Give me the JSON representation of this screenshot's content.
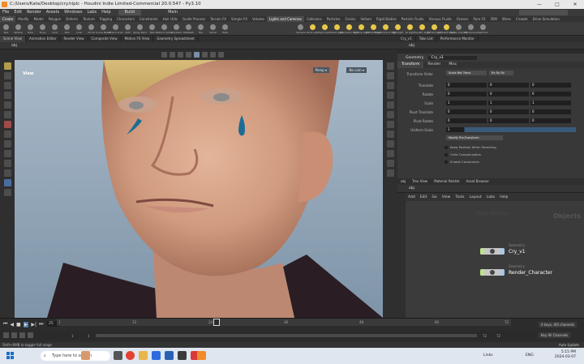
{
  "window": {
    "title": "C:/Users/Kate/Desktop/cry.hiplc - Houdini Indie Limited-Commercial 20.0.547 - Py3.10",
    "controls": [
      "—",
      "□",
      "✕"
    ]
  },
  "menu": {
    "items": [
      "File",
      "Edit",
      "Render",
      "Assets",
      "Windows",
      "Labs",
      "Help"
    ],
    "desktop": "Build",
    "right_desktop": "Main"
  },
  "shelf_tabs": [
    "Create",
    "Modify",
    "Model",
    "Polygon",
    "Deform",
    "Texture",
    "Rigging",
    "Characters",
    "Constraints",
    "Hair Utils",
    "Guide Process",
    "Terrain FX",
    "Simple FX",
    "Volume",
    "Lights and Cameras",
    "Collisions",
    "Particles",
    "Grains",
    "Vellum",
    "Rigid Bodies",
    "Particle Fluids",
    "Viscous Fluids",
    "Oceans",
    "Pyro FX",
    "FEM",
    "Wires",
    "Crowds",
    "Drive Simulation"
  ],
  "shelf_tools_left": [
    "Box",
    "Sphere",
    "Tube",
    "Torus",
    "Grid",
    "Null",
    "Line",
    "Circle",
    "Curve Bezier",
    "Draw Curve",
    "Path",
    "Spray Paint",
    "Text",
    "Platonic Solids",
    "L-System",
    "Metaball",
    "File",
    "Spiral",
    "Helix"
  ],
  "shelf_tools_right": [
    "Camera",
    "Point Light",
    "Spot Light",
    "Area Light",
    "Geometry Light",
    "Volume Light",
    "Distant Light",
    "Environment Light",
    "Sky Light",
    "GI Light",
    "Caustic Light",
    "Portal Light",
    "Ambient Light",
    "Stereo Camera",
    "VR Camera",
    "Switcher"
  ],
  "pane_tabs_left": [
    "Scene View",
    "Animation Editor",
    "Render View",
    "Composite View",
    "Motion FX View",
    "Geometry Spreadsheet"
  ],
  "pane_tabs_right": [
    "Cry_v1",
    "Take List",
    "Performance Monitor"
  ],
  "viewport": {
    "path": "obj",
    "label": "View",
    "persp": "Persp ▾",
    "cam": "No cam ▾"
  },
  "params": {
    "path": "obj",
    "node_type": "Geometry",
    "node_name": "Cry_v1",
    "tabs": [
      "Transform",
      "Render",
      "Misc"
    ],
    "transform_order_label": "Transform Order",
    "transform_order": "Scale Rot Trans",
    "rotate_order": "Rx Ry Rz",
    "rows": [
      {
        "label": "Translate",
        "values": [
          "0",
          "0",
          "0"
        ]
      },
      {
        "label": "Rotate",
        "values": [
          "0",
          "0",
          "0"
        ]
      },
      {
        "label": "Scale",
        "values": [
          "1",
          "1",
          "1"
        ]
      },
      {
        "label": "Pivot Translate",
        "values": [
          "0",
          "0",
          "0"
        ]
      },
      {
        "label": "Pivot Rotate",
        "values": [
          "0",
          "0",
          "0"
        ]
      }
    ],
    "uniform_scale_label": "Uniform Scale",
    "uniform_scale": "1",
    "modify_pre_transform": "Modify Pre-Transform",
    "checkboxes": [
      "Keep Position When Parenting",
      "Child Compensation",
      "Enable Constraints"
    ]
  },
  "network": {
    "tabs": [
      "obj",
      "Tree View",
      "Material Palette",
      "Asset Browser"
    ],
    "path": "obj",
    "menu": [
      "Add",
      "Edit",
      "Go",
      "View",
      "Tools",
      "Layout",
      "Labs",
      "Help"
    ],
    "watermark": "Indie Edition",
    "context_label": "Objects",
    "nodes": [
      {
        "type": "Geometry",
        "name": "Cry_v1"
      },
      {
        "type": "Geometry",
        "name": "Render_Character"
      }
    ]
  },
  "timeline": {
    "frame": "25",
    "start": "1",
    "start2": "1",
    "end": "72",
    "end2": "72",
    "keys_label": "0 keys, 0/0 channels",
    "key_all": "Key All Channels",
    "auto_update": "Auto Update",
    "ticks": [
      "1",
      "12",
      "24",
      "36",
      "48",
      "60",
      "72"
    ]
  },
  "status": {
    "text": "Shift+RMB to toggle full range"
  },
  "taskbar": {
    "search": "Type here to search",
    "links": "Links",
    "lang": "ENG",
    "time": "5:15 PM",
    "date": "2024-03-07"
  },
  "colors": {
    "accent_orange": "#f28c28",
    "node_green": "#bde28c",
    "node_blue": "#a7c8e8",
    "tear_blue": "#1d6c96"
  }
}
